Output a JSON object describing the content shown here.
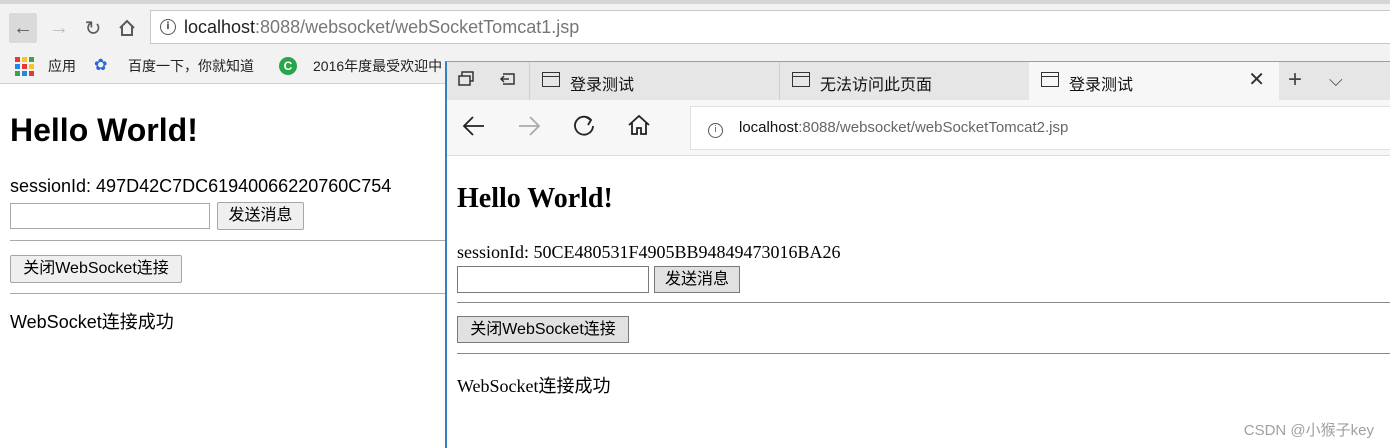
{
  "chrome": {
    "url_host": "localhost",
    "url_rest": ":8088/websocket/webSocketTomcat1.jsp",
    "info_icon": "i",
    "bookmarks": [
      {
        "label": "应用"
      },
      {
        "label": "百度一下，你就知道"
      },
      {
        "label": "2016年度最受欢迎中"
      }
    ],
    "page": {
      "heading": "Hello World!",
      "session_line": "sessionId: 497D42C7DC61940066220760C754",
      "send_button": "发送消息",
      "close_button": "关闭WebSocket连接",
      "status": "WebSocket连接成功"
    }
  },
  "edge": {
    "tabs": [
      {
        "label": "登录测试",
        "active": false
      },
      {
        "label": "无法访问此页面",
        "active": false
      },
      {
        "label": "登录测试",
        "active": true
      }
    ],
    "tab_close_glyph": "✕",
    "new_tab_glyph": "+",
    "tab_menu_glyph": "⌵",
    "url_host": "localhost",
    "url_rest": ":8088/websocket/webSocketTomcat2.jsp",
    "info_icon": "i",
    "page": {
      "heading": "Hello World!",
      "session_line": "sessionId: 50CE480531F4905BB94849473016BA26",
      "send_button": "发送消息",
      "close_button": "关闭WebSocket连接",
      "status": "WebSocket连接成功"
    }
  },
  "watermark": "CSDN @小猴子key",
  "colors": {
    "edge_border": "#3b7dbf",
    "chrome_green": "#2aa54c",
    "baidu_blue": "#2a66d9"
  }
}
